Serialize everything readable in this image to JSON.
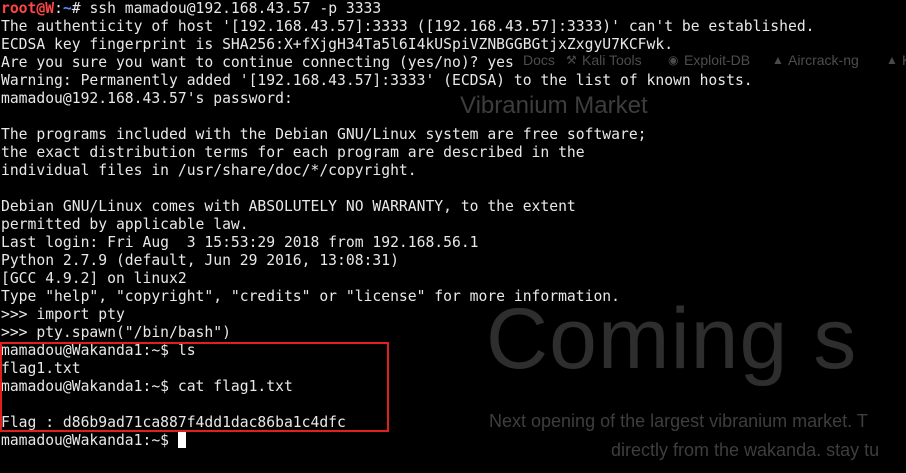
{
  "background_page": {
    "bookmarks": [
      {
        "label": "Docs",
        "icon": "docs-icon"
      },
      {
        "label": "Kali Tools",
        "icon": "kali-tools-icon"
      },
      {
        "label": "Exploit-DB",
        "icon": "exploit-db-icon"
      },
      {
        "label": "Aircrack-ng",
        "icon": "aircrack-icon"
      },
      {
        "label": "K",
        "icon": "kali-icon"
      }
    ],
    "title": "Vibranium Market",
    "headline": "Coming s",
    "subtext_line1": "Next opening of the largest vibranium market. T",
    "subtext_line2": "directly from the wakanda. stay tu"
  },
  "terminal": {
    "prompt_root": {
      "user": "root@W",
      "sep": ":",
      "path": "~",
      "symbol": "# ",
      "command": "ssh mamadou@192.168.43.57 -p 3333"
    },
    "lines": [
      "The authenticity of host '[192.168.43.57]:3333 ([192.168.43.57]:3333)' can't be established.",
      "ECDSA key fingerprint is SHA256:X+fXjgH34Ta5l6I4kUSpiVZNBGGBGtjxZxgyU7KCFwk.",
      "Are you sure you want to continue connecting (yes/no)? yes",
      "Warning: Permanently added '[192.168.43.57]:3333' (ECDSA) to the list of known hosts.",
      "mamadou@192.168.43.57's password: ",
      "",
      "The programs included with the Debian GNU/Linux system are free software;",
      "the exact distribution terms for each program are described in the",
      "individual files in /usr/share/doc/*/copyright.",
      "",
      "Debian GNU/Linux comes with ABSOLUTELY NO WARRANTY, to the extent",
      "permitted by applicable law.",
      "Last login: Fri Aug  3 15:53:29 2018 from 192.168.56.1",
      "Python 2.7.9 (default, Jun 29 2016, 13:08:31)",
      "[GCC 4.9.2] on linux2",
      "Type \"help\", \"copyright\", \"credits\" or \"license\" for more information.",
      ">>> import pty",
      ">>> pty.spawn(\"/bin/bash\")",
      "mamadou@Wakanda1:~$ ls",
      "flag1.txt",
      "mamadou@Wakanda1:~$ cat flag1.txt",
      "",
      "Flag : d86b9ad71ca887f4dd1dac86ba1c4dfc"
    ],
    "last_prompt": "mamadou@Wakanda1:~$ "
  },
  "colors": {
    "root_user": "#ff4545",
    "path": "#5a8cff",
    "text": "#e8e8e8",
    "highlight_box": "#e11f1f",
    "background": "#000000"
  }
}
